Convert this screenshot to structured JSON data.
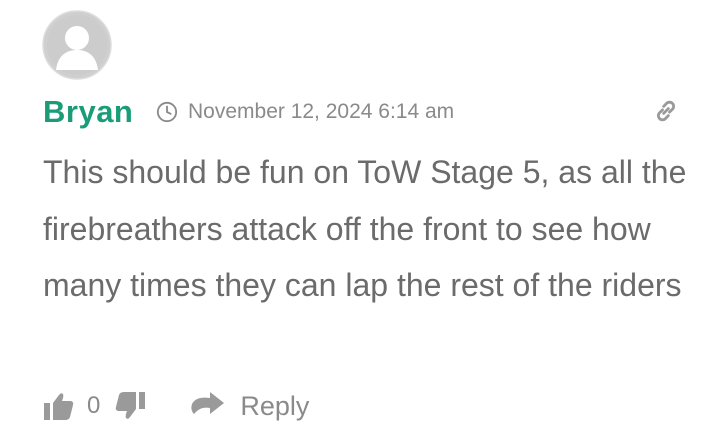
{
  "comment": {
    "author": "Bryan",
    "timestamp": "November 12, 2024 6:14 am",
    "body": "This should be fun on ToW Stage 5, as all the firebreathers attack off the front to see how many times they can lap the rest of the riders",
    "likes": "0",
    "reply_label": "Reply"
  },
  "icons": {
    "avatar": "default-avatar-icon",
    "clock": "clock-icon",
    "permalink": "link-icon",
    "like": "thumbs-up-icon",
    "dislike": "thumbs-down-icon",
    "reply": "reply-arrow-icon"
  },
  "colors": {
    "author": "#1a9c78",
    "text": "#6b6b6b",
    "meta": "#8a8a8a",
    "icons": "#a5a5a5"
  }
}
